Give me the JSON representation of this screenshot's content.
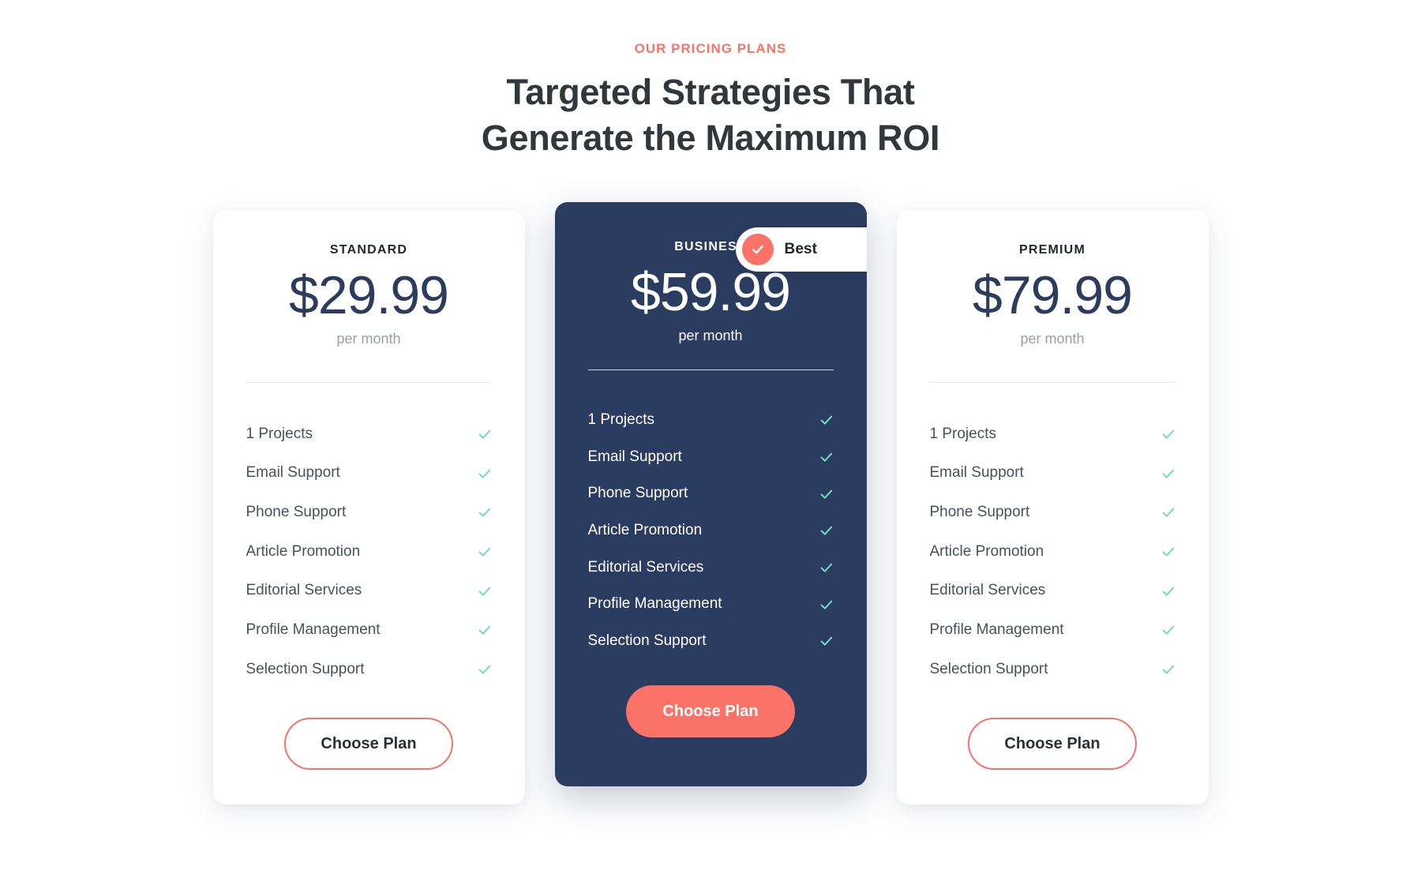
{
  "header": {
    "eyebrow": "OUR PRICING PLANS",
    "headline_line1": "Targeted Strategies That",
    "headline_line2": "Generate the Maximum ROI"
  },
  "colors": {
    "accent_coral": "#fa7268",
    "featured_card_bg": "#2a3c60",
    "check_green": "#72dcc0",
    "price_navy": "#2b3c5e",
    "heading_dark": "#32373c",
    "muted_text": "#9aa0a8",
    "page_bg": "#ffffff"
  },
  "badge": {
    "label": "Best",
    "icon": "check-icon"
  },
  "plans": [
    {
      "id": "standard",
      "name": "STANDARD",
      "price": "$29.99",
      "period": "per month",
      "featured": false,
      "cta_label": "Choose Plan",
      "features": [
        {
          "label": "1 Projects",
          "included": true
        },
        {
          "label": "Email Support",
          "included": true
        },
        {
          "label": "Phone Support",
          "included": true
        },
        {
          "label": "Article Promotion",
          "included": true
        },
        {
          "label": "Editorial Services",
          "included": true
        },
        {
          "label": "Profile Management",
          "included": true
        },
        {
          "label": "Selection Support",
          "included": true
        }
      ]
    },
    {
      "id": "business",
      "name": "BUSINESS",
      "price": "$59.99",
      "period": "per month",
      "featured": true,
      "badge_label": "Best",
      "cta_label": "Choose Plan",
      "features": [
        {
          "label": "1 Projects",
          "included": true
        },
        {
          "label": "Email Support",
          "included": true
        },
        {
          "label": "Phone Support",
          "included": true
        },
        {
          "label": "Article Promotion",
          "included": true
        },
        {
          "label": "Editorial Services",
          "included": true
        },
        {
          "label": "Profile Management",
          "included": true
        },
        {
          "label": "Selection Support",
          "included": true
        }
      ]
    },
    {
      "id": "premium",
      "name": "PREMIUM",
      "price": "$79.99",
      "period": "per month",
      "featured": false,
      "cta_label": "Choose Plan",
      "features": [
        {
          "label": "1 Projects",
          "included": true
        },
        {
          "label": "Email Support",
          "included": true
        },
        {
          "label": "Phone Support",
          "included": true
        },
        {
          "label": "Article Promotion",
          "included": true
        },
        {
          "label": "Editorial Services",
          "included": true
        },
        {
          "label": "Profile Management",
          "included": true
        },
        {
          "label": "Selection Support",
          "included": true
        }
      ]
    }
  ]
}
